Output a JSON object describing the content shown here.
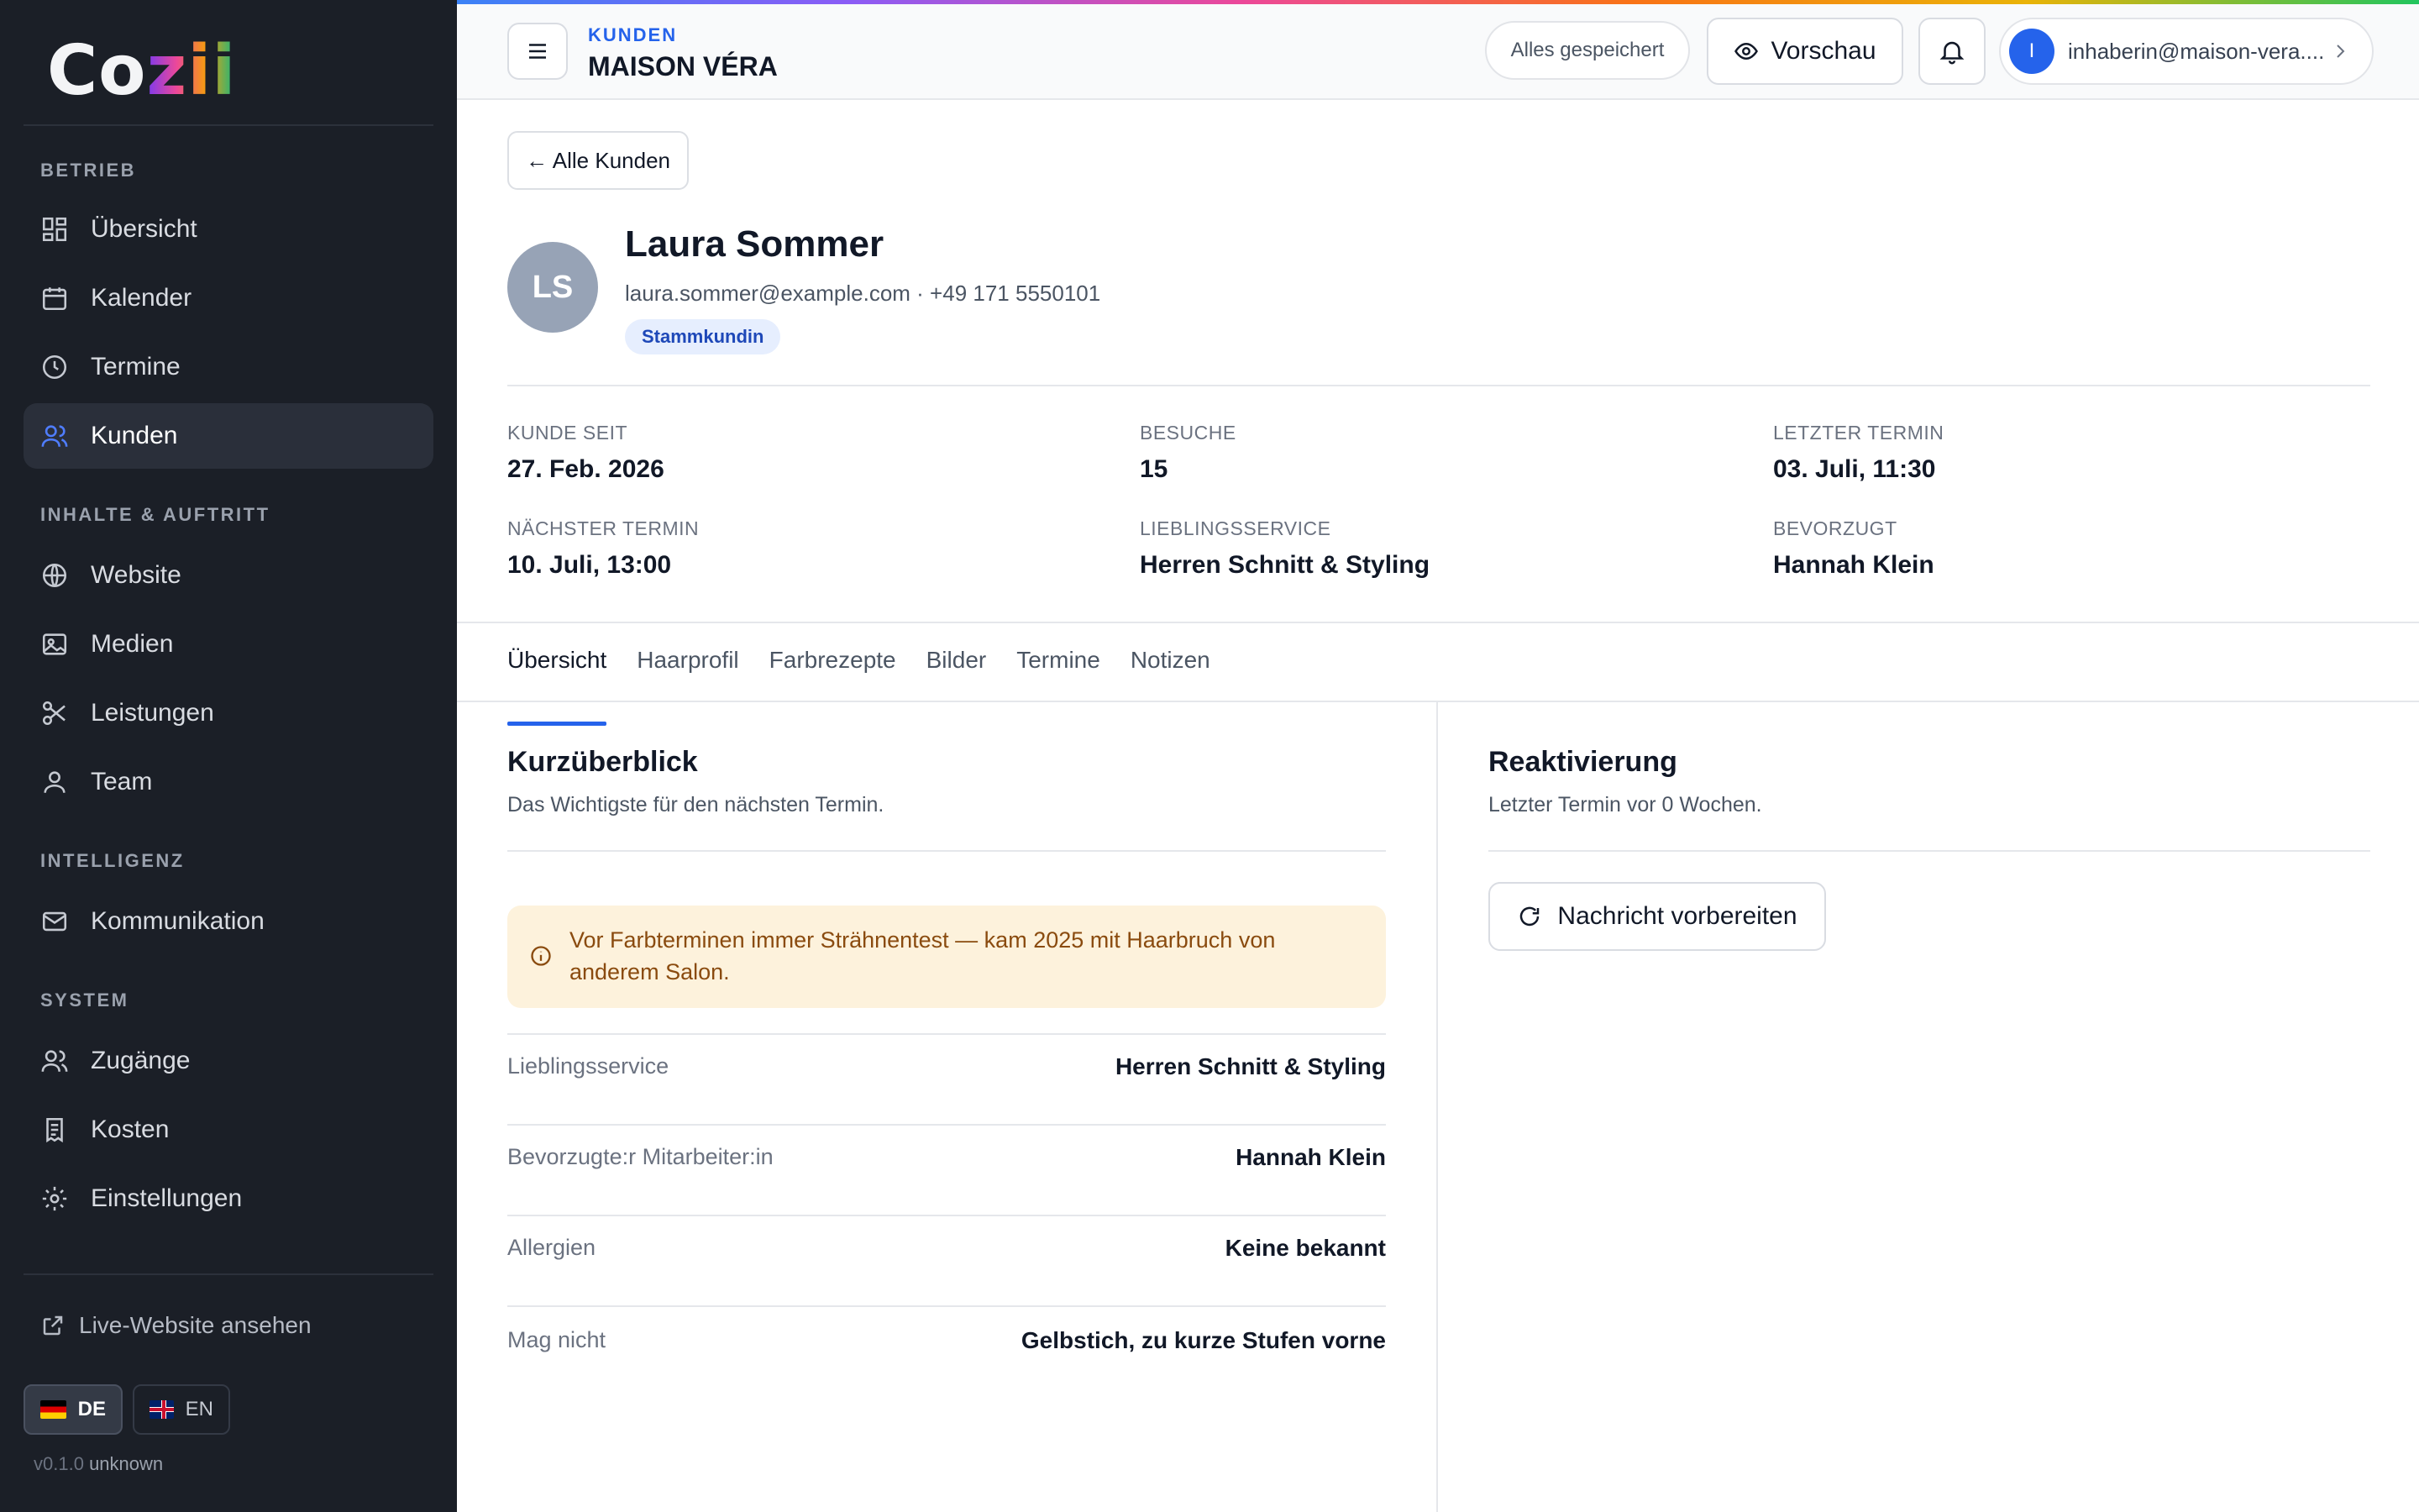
{
  "sidebar": {
    "logo": {
      "prefix": "Co",
      "accent": "zii"
    },
    "sections": {
      "betrieb": "BETRIEB",
      "inhalte": "INHALTE & AUFTRITT",
      "intelligenz": "INTELLIGENZ",
      "system": "SYSTEM"
    },
    "items": {
      "uebersicht": "Übersicht",
      "kalender": "Kalender",
      "termine": "Termine",
      "kunden": "Kunden",
      "website": "Website",
      "medien": "Medien",
      "leistungen": "Leistungen",
      "team": "Team",
      "kommunikation": "Kommunikation",
      "zugaenge": "Zugänge",
      "kosten": "Kosten",
      "einstellungen": "Einstellungen"
    },
    "live_link": "Live-Website ansehen",
    "lang_de": "DE",
    "lang_en": "EN",
    "version": "v0.1.0",
    "version_suffix": "unknown"
  },
  "topbar": {
    "section": "KUNDEN",
    "title": "MAISON VÉRA",
    "saved": "Alles gespeichert",
    "preview": "Vorschau",
    "user_initial": "I",
    "user_email": "inhaberin@maison-vera...."
  },
  "customer": {
    "back": "← Alle Kunden",
    "initials": "LS",
    "name": "Laura Sommer",
    "contact": "laura.sommer@example.com · +49 171 5550101",
    "badge": "Stammkundin"
  },
  "stats": {
    "since_label": "KUNDE SEIT",
    "since_value": "27. Feb. 2026",
    "visits_label": "BESUCHE",
    "visits_value": "15",
    "last_label": "LETZTER TERMIN",
    "last_value": "03. Juli, 11:30",
    "next_label": "NÄCHSTER TERMIN",
    "next_value": "10. Juli, 13:00",
    "fav_label": "LIEBLINGSSERVICE",
    "fav_value": "Herren Schnitt & Styling",
    "pref_label": "BEVORZUGT",
    "pref_value": "Hannah Klein"
  },
  "tabs": {
    "uebersicht": "Übersicht",
    "haarprofil": "Haarprofil",
    "farbrezepte": "Farbrezepte",
    "bilder": "Bilder",
    "termine": "Termine",
    "notizen": "Notizen"
  },
  "overview": {
    "title": "Kurzüberblick",
    "subtitle": "Das Wichtigste für den nächsten Termin.",
    "alert_line1": "Vor Farbterminen immer Strähnentest — kam 2025 mit Haarbruch von",
    "alert_line2": "anderem Salon.",
    "rows": {
      "fav_label": "Lieblingsservice",
      "fav_value": "Herren Schnitt & Styling",
      "staff_label": "Bevorzugte:r Mitarbeiter:in",
      "staff_value": "Hannah Klein",
      "allergy_label": "Allergien",
      "allergy_value": "Keine bekannt",
      "dislike_label": "Mag nicht",
      "dislike_value": "Gelbstich, zu kurze Stufen vorne"
    }
  },
  "reactivation": {
    "title": "Reaktivierung",
    "subtitle": "Letzter Termin vor 0 Wochen.",
    "button": "Nachricht vorbereiten"
  }
}
